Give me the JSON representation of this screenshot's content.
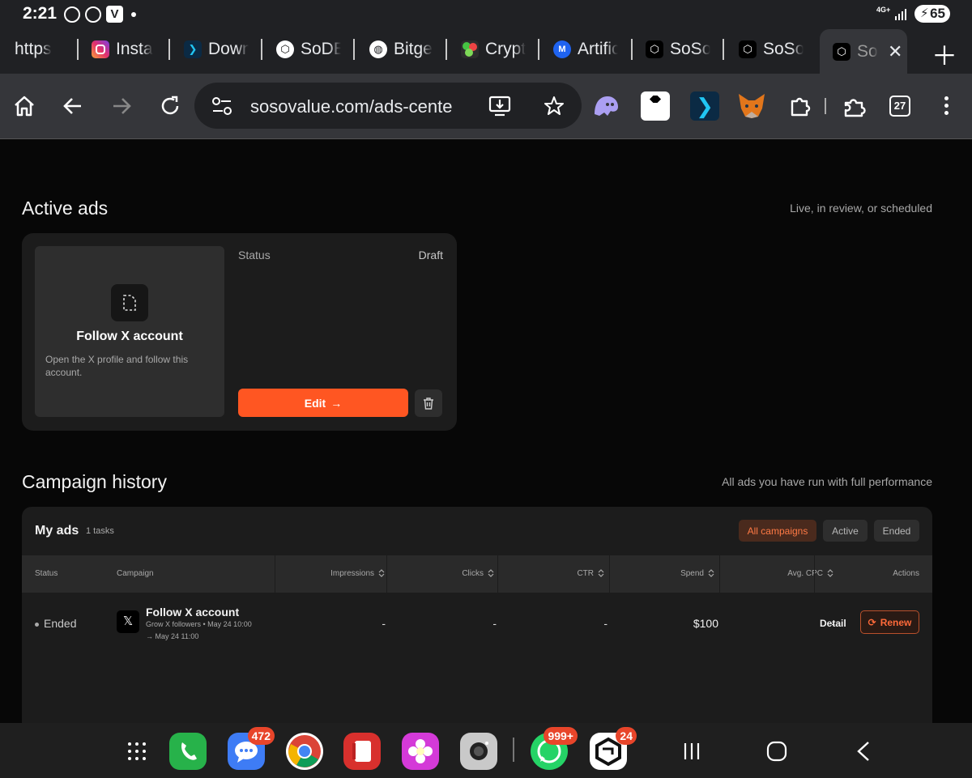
{
  "statusbar": {
    "time": "2:21",
    "network": "4G+",
    "battery": "65"
  },
  "tabs": [
    {
      "label": "https",
      "icon": "none"
    },
    {
      "label": "Insta",
      "icon": "instagram-icon"
    },
    {
      "label": "Down",
      "icon": "arrow-app-icon"
    },
    {
      "label": "SoDE",
      "icon": "sosovalue-icon"
    },
    {
      "label": "Bitge",
      "icon": "globe-icon"
    },
    {
      "label": "Crypt",
      "icon": "crypt-icon"
    },
    {
      "label": "Artific",
      "icon": "coinmarketcap-icon"
    },
    {
      "label": "SoSo",
      "icon": "sosovalue-icon"
    },
    {
      "label": "SoSo",
      "icon": "sosovalue-icon"
    },
    {
      "label": "So",
      "icon": "sosovalue-icon"
    }
  ],
  "toolbar": {
    "url": "sosovalue.com/ads-cente",
    "tab_count": "27"
  },
  "active_ads": {
    "title": "Active ads",
    "subtitle": "Live, in review, or scheduled",
    "card": {
      "name": "Follow X account",
      "description": "Open the X profile and follow this account.",
      "status_label": "Status",
      "status_value": "Draft",
      "edit_label": "Edit"
    }
  },
  "campaign_history": {
    "title": "Campaign history",
    "subtitle": "All ads you have run with full performance",
    "table_title": "My ads",
    "task_count": "1 tasks",
    "filters": [
      "All campaigns",
      "Active",
      "Ended"
    ],
    "selected_filter": "All campaigns",
    "columns": [
      "Status",
      "Campaign",
      "Impressions",
      "Clicks",
      "CTR",
      "Spend",
      "Avg. CPC",
      "Actions"
    ],
    "rows": [
      {
        "status": "Ended",
        "campaign_name": "Follow X account",
        "campaign_meta": "Grow X followers • May 24 10:00",
        "campaign_end": "→ May 24 11:00",
        "impressions": "-",
        "clicks": "-",
        "ctr": "-",
        "spend": "$100",
        "avg_cpc": "-",
        "action_detail": "Detail",
        "action_renew": "Renew"
      }
    ]
  },
  "dock": {
    "messages_badge": "472",
    "whatsapp_badge": "999+",
    "sosovalue_badge": "24"
  },
  "colors": {
    "accent": "#ff5622",
    "background": "#070707",
    "card": "#1c1c1c"
  }
}
